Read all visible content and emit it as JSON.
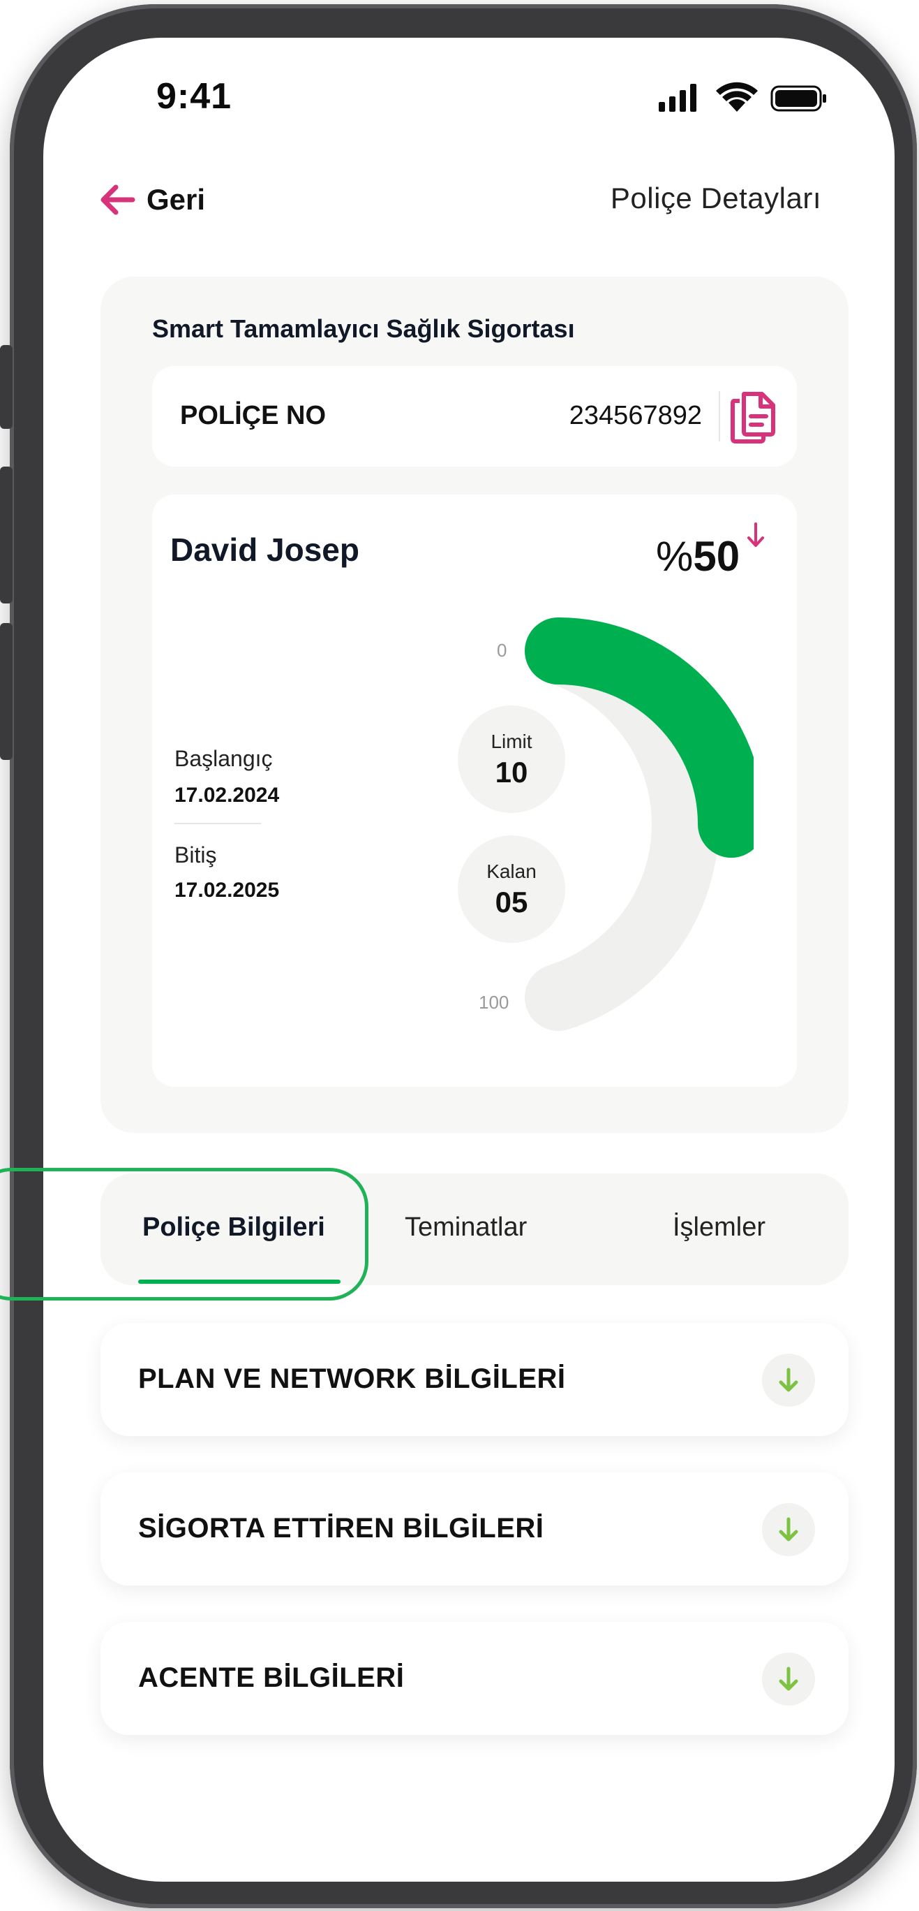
{
  "status_bar": {
    "time": "9:41"
  },
  "header": {
    "back_label": "Geri",
    "title": "Poliçe Detayları"
  },
  "policy": {
    "product_name": "Smart Tamamlayıcı Sağlık Sigortası",
    "number_label": "POLİÇE NO",
    "number": "234567892"
  },
  "usage": {
    "holder_name": "David Josep",
    "percent_symbol": "%",
    "percent_value": "50",
    "start_label": "Başlangıç",
    "start_date": "17.02.2024",
    "end_label": "Bitiş",
    "end_date": "17.02.2025",
    "gauge_min": "0",
    "gauge_max": "100",
    "gauge_progress_percent": 50,
    "limit_label": "Limit",
    "limit_value": "10",
    "remaining_label": "Kalan",
    "remaining_value": "05"
  },
  "tabs": [
    {
      "label": "Poliçe Bilgileri",
      "active": true
    },
    {
      "label": "Teminatlar",
      "active": false
    },
    {
      "label": "İşlemler",
      "active": false
    }
  ],
  "sections": [
    {
      "title": "PLAN VE NETWORK BİLGİLERİ"
    },
    {
      "title": "SİGORTA ETTİREN BİLGİLERİ"
    },
    {
      "title": "ACENTE BİLGİLERİ"
    }
  ],
  "colors": {
    "accent_pink": "#d6337a",
    "progress_green": "#00b050",
    "gauge_track": "#f0f1ee",
    "expand_arrow_green": "#7dc243"
  },
  "icons": {
    "back": "arrow-left-icon",
    "copy": "copy-document-icon",
    "trend": "arrow-down-icon",
    "expand": "arrow-down-icon"
  }
}
